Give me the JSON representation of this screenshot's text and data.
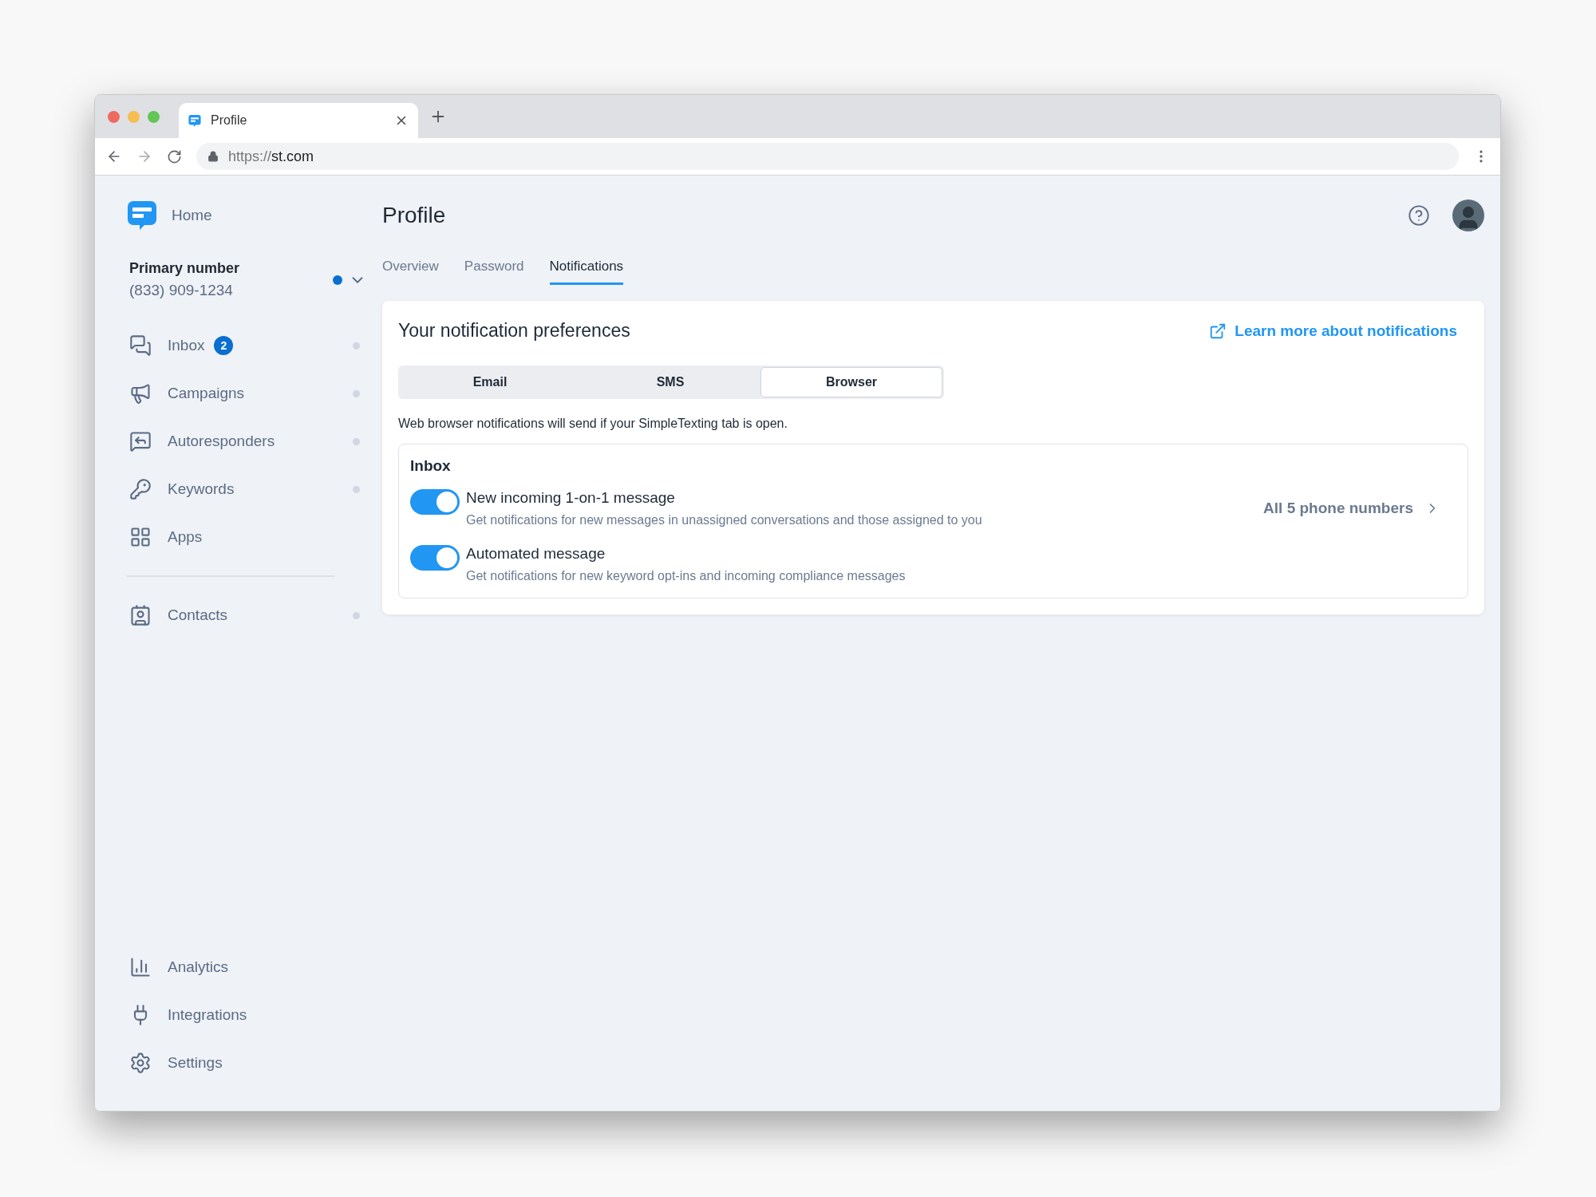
{
  "browser": {
    "tab_title": "Profile",
    "url_scheme": "https://",
    "url_host": "st.com"
  },
  "sidebar": {
    "home": "Home",
    "primary_number": {
      "label": "Primary number",
      "value": "(833) 909-1234",
      "active": true
    },
    "items": [
      {
        "label": "Inbox",
        "badge": "2",
        "indicator": true
      },
      {
        "label": "Campaigns",
        "indicator": true
      },
      {
        "label": "Autoresponders",
        "indicator": true
      },
      {
        "label": "Keywords",
        "indicator": true
      },
      {
        "label": "Apps",
        "indicator": false
      }
    ],
    "more_items": [
      {
        "label": "Contacts",
        "indicator": true
      }
    ],
    "bottom_items": [
      {
        "label": "Analytics"
      },
      {
        "label": "Integrations"
      },
      {
        "label": "Settings"
      }
    ]
  },
  "page": {
    "title": "Profile",
    "tabs": [
      {
        "label": "Overview",
        "selected": false
      },
      {
        "label": "Password",
        "selected": false
      },
      {
        "label": "Notifications",
        "selected": true
      }
    ]
  },
  "card": {
    "title": "Your notification preferences",
    "link": "Learn more about notifications",
    "channels": [
      {
        "label": "Email",
        "selected": false
      },
      {
        "label": "SMS",
        "selected": false
      },
      {
        "label": "Browser",
        "selected": true
      }
    ],
    "note": "Web browser notifications will send if your SimpleTexting tab is open.",
    "section": {
      "title": "Inbox",
      "settings": [
        {
          "title": "New incoming 1-on-1 message",
          "description": "Get notifications for new messages in unassigned conversations and those assigned to you",
          "on": true,
          "scope": "All 5 phone numbers"
        },
        {
          "title": "Automated message",
          "description": "Get notifications for new keyword opt-ins and incoming compliance messages",
          "on": true
        }
      ]
    }
  }
}
